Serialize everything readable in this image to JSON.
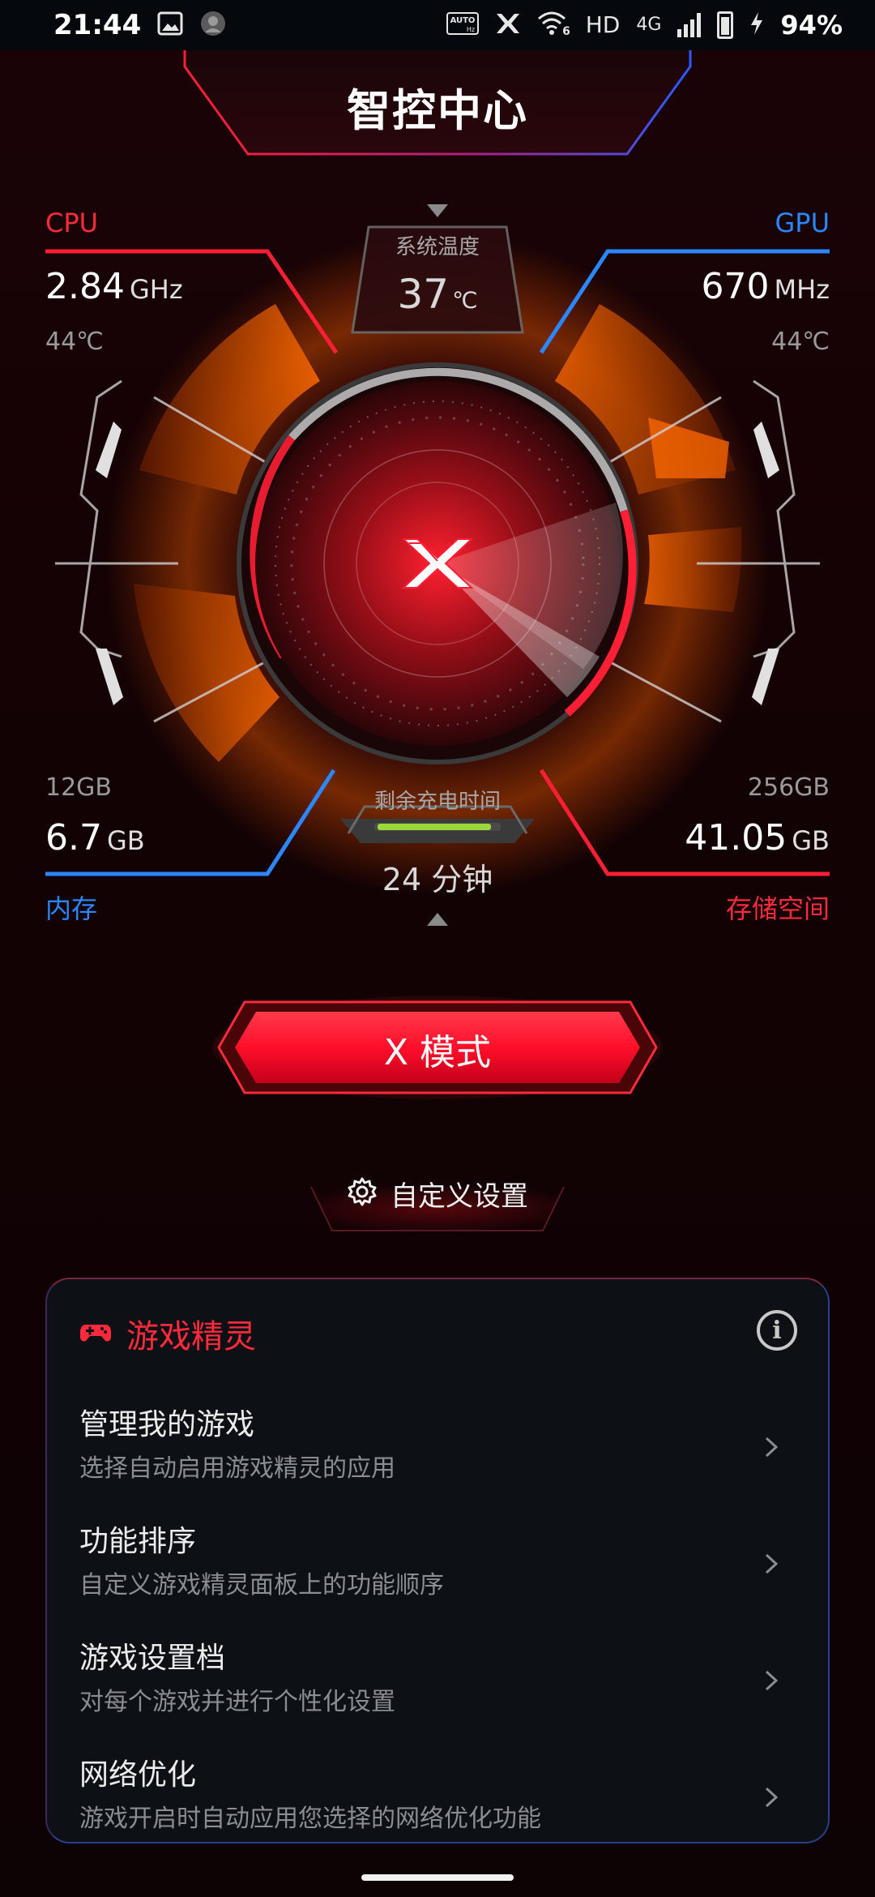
{
  "status_bar": {
    "time": "21:44",
    "network_type": "4G",
    "hd_label": "HD",
    "auto_hz_label": "AUTO Hz",
    "battery_percent": "94%"
  },
  "header": {
    "title": "智控中心"
  },
  "cpu": {
    "label": "CPU",
    "frequency": "2.84",
    "frequency_unit": "GHz",
    "temperature": "44℃"
  },
  "gpu": {
    "label": "GPU",
    "frequency": "670",
    "frequency_unit": "MHz",
    "temperature": "44℃"
  },
  "system_temp": {
    "label": "系统温度",
    "value": "37",
    "unit": "℃"
  },
  "charging": {
    "label": "剩余充电时间",
    "value": "24 分钟"
  },
  "memory": {
    "label": "内存",
    "total": "12GB",
    "used": "6.7",
    "used_unit": "GB"
  },
  "storage": {
    "label": "存储空间",
    "total": "256GB",
    "used": "41.05",
    "used_unit": "GB"
  },
  "mode_button": {
    "label": "X 模式"
  },
  "custom_settings": {
    "label": "自定义设置"
  },
  "game_genie": {
    "title": "游戏精灵",
    "items": [
      {
        "title": "管理我的游戏",
        "subtitle": "选择自动启用游戏精灵的应用"
      },
      {
        "title": "功能排序",
        "subtitle": "自定义游戏精灵面板上的功能顺序"
      },
      {
        "title": "游戏设置档",
        "subtitle": "对每个游戏并进行个性化设置"
      },
      {
        "title": "网络优化",
        "subtitle": "游戏开启时自动应用您选择的网络优化功能"
      }
    ]
  },
  "colors": {
    "accent_red": "#ff2a3b",
    "accent_blue": "#2b86ff",
    "orange": "#ff6a00"
  }
}
